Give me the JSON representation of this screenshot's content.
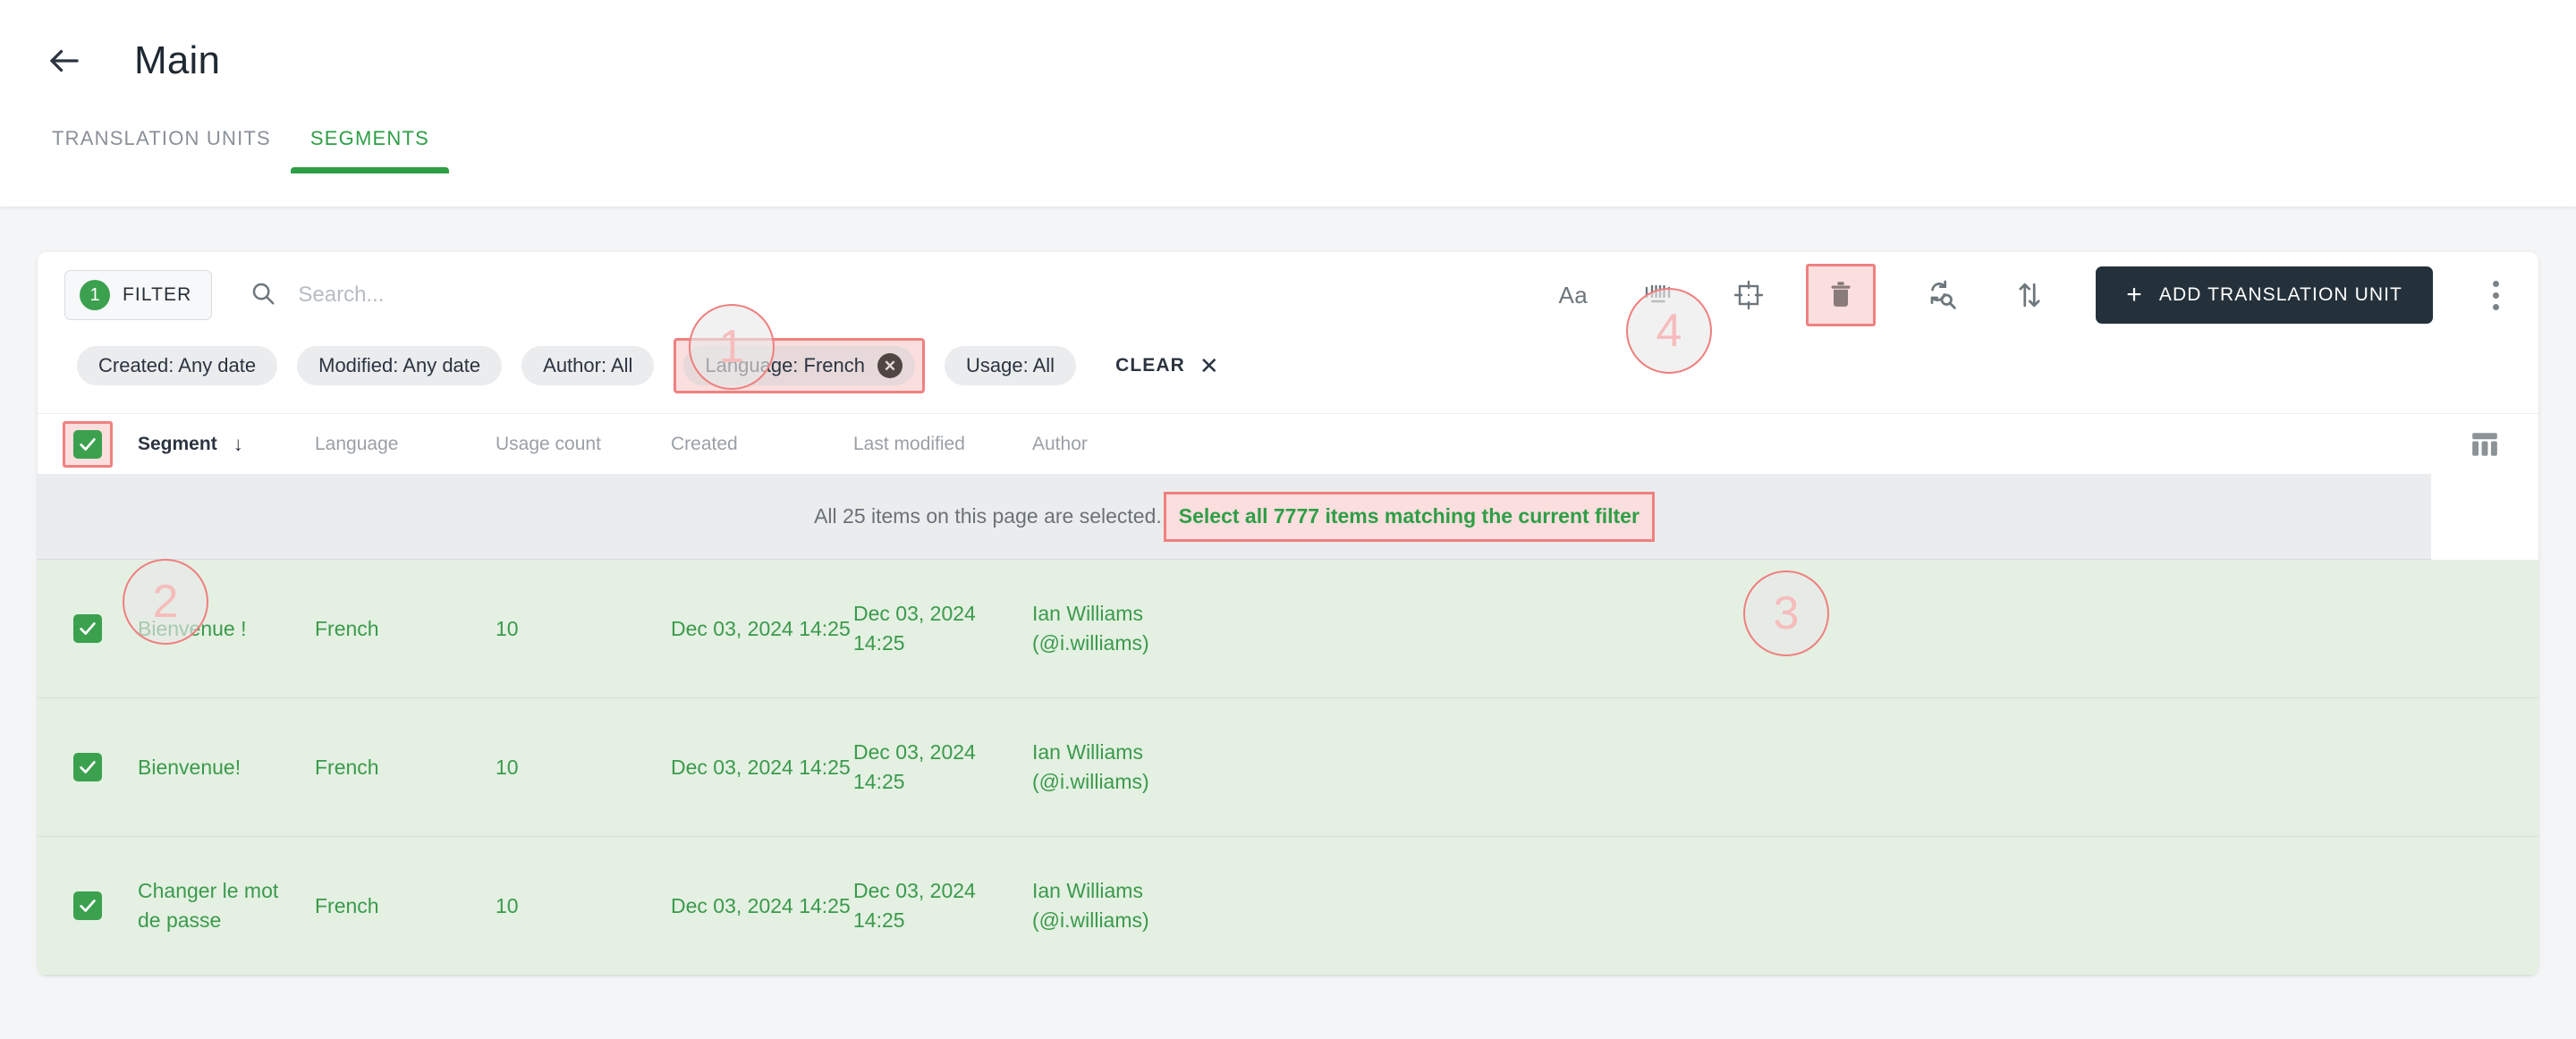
{
  "header": {
    "back_icon": "arrow-left-icon",
    "title": "Main"
  },
  "tabs": [
    {
      "label": "TRANSLATION UNITS",
      "active": false
    },
    {
      "label": "SEGMENTS",
      "active": true
    }
  ],
  "toolbar": {
    "filter_label": "FILTER",
    "filter_count": "1",
    "search_placeholder": "Search...",
    "search_value": "",
    "search_icon": "search-icon",
    "match_case_label": "Aa",
    "whole_word_icon": "whole-word-icon",
    "regex_icon": "regex-icon",
    "delete_icon": "trash-icon",
    "find_replace_icon": "find-replace-icon",
    "sort_icon": "sort-arrows-icon",
    "add_label": "ADD TRANSLATION UNIT",
    "add_plus": "+",
    "more_icon": "kebab-menu-icon"
  },
  "filters": {
    "chips": [
      {
        "label": "Created: Any date",
        "active": false,
        "highlighted": false
      },
      {
        "label": "Modified: Any date",
        "active": false,
        "highlighted": false
      },
      {
        "label": "Author: All",
        "active": false,
        "highlighted": false
      },
      {
        "label": "Language: French",
        "active": true,
        "highlighted": true
      },
      {
        "label": "Usage: All",
        "active": false,
        "highlighted": false
      }
    ],
    "clear_label": "CLEAR",
    "clear_x": "✕"
  },
  "table": {
    "columns": [
      {
        "label": "Segment",
        "sorted": true,
        "sort_arrow": "↓"
      },
      {
        "label": "Language",
        "sorted": false
      },
      {
        "label": "Usage count",
        "sorted": false
      },
      {
        "label": "Created",
        "sorted": false
      },
      {
        "label": "Last modified",
        "sorted": false
      },
      {
        "label": "Author",
        "sorted": false
      }
    ],
    "columns_settings_icon": "table-columns-icon",
    "header_checkbox_checked": true,
    "banner": {
      "text": "All 25 items on this page are selected.",
      "link": "Select all 7777 items matching the current filter"
    },
    "rows": [
      {
        "checked": true,
        "segment": "Bienvenue !",
        "language": "French",
        "usage_count": "10",
        "created": "Dec 03, 2024 14:25",
        "last_modified": "Dec 03, 2024 14:25",
        "author_name": "Ian Williams",
        "author_handle": "(@i.williams)"
      },
      {
        "checked": true,
        "segment": "Bienvenue!",
        "language": "French",
        "usage_count": "10",
        "created": "Dec 03, 2024 14:25",
        "last_modified": "Dec 03, 2024 14:25",
        "author_name": "Ian Williams",
        "author_handle": "(@i.williams)"
      },
      {
        "checked": true,
        "segment": "Changer le mot de passe",
        "language": "French",
        "usage_count": "10",
        "created": "Dec 03, 2024 14:25",
        "last_modified": "Dec 03, 2024 14:25",
        "author_name": "Ian Williams",
        "author_handle": "(@i.williams)"
      }
    ]
  },
  "annotations": [
    {
      "number": "1"
    },
    {
      "number": "2"
    },
    {
      "number": "3"
    },
    {
      "number": "4"
    }
  ],
  "colors": {
    "accent_green": "#2e9e46",
    "row_green_bg": "#e4f0e2",
    "row_green_text": "#3a9a4c",
    "dark_button": "#24313b",
    "highlight_red": "#f08080",
    "highlight_red_bg": "#fbdede",
    "page_bg": "#f4f5f7"
  }
}
